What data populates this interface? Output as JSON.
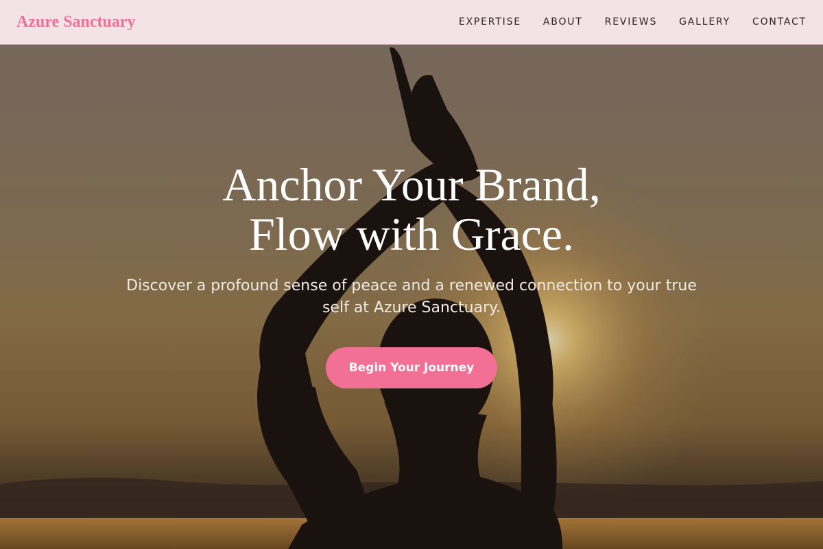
{
  "brand": {
    "name": "Azure Sanctuary",
    "color": "#ee7096"
  },
  "nav": {
    "items": [
      {
        "label": "EXPERTISE"
      },
      {
        "label": "ABOUT"
      },
      {
        "label": "REVIEWS"
      },
      {
        "label": "GALLERY"
      },
      {
        "label": "CONTACT"
      }
    ]
  },
  "hero": {
    "title_line1": "Anchor Your Brand,",
    "title_line2": "Flow with Grace.",
    "subtitle": "Discover a profound sense of peace and a renewed connection to your true self at Azure Sanctuary.",
    "cta_label": "Begin Your Journey",
    "cta_color": "#f26f95",
    "background_image": "silhouette of person with raised arms at sunset"
  },
  "colors": {
    "nav_bg": "#f4e3e6",
    "accent": "#f26f95"
  }
}
